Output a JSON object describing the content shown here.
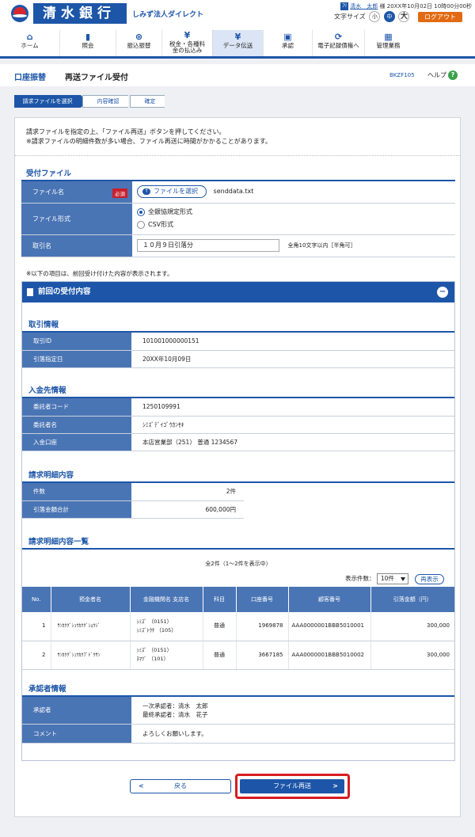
{
  "header": {
    "bank_name": "清水銀行",
    "service_name": "しみず法人ダイレクト",
    "user_icon_label": "ﾌﾘ",
    "user_name": "清水　太郎",
    "user_suffix": "様",
    "login_datetime": "20XX年10月02日 10時00分00秒",
    "font_size_label": "文字サイズ",
    "font_small": "小",
    "font_medium": "中",
    "font_large": "大",
    "logout": "ログアウト"
  },
  "nav": {
    "items": [
      {
        "label": "ホーム",
        "icon": "home-icon"
      },
      {
        "label": "照会",
        "icon": "document-icon"
      },
      {
        "label": "振込振替",
        "icon": "transfer-icon"
      },
      {
        "label": "税金・各種料金の払込み",
        "icon": "yen-icon"
      },
      {
        "label": "データ伝送",
        "icon": "data-transfer-icon"
      },
      {
        "label": "承認",
        "icon": "approval-icon"
      },
      {
        "label": "電子記録債権へ",
        "icon": "e-claim-icon"
      },
      {
        "label": "管理業務",
        "icon": "admin-icon"
      }
    ],
    "active_index": 4
  },
  "title": {
    "category": "口座振替",
    "main": "再送ファイル受付",
    "screen_id": "BKZF105",
    "help": "ヘルプ"
  },
  "steps": [
    "請求ファイルを選択",
    "内容確認",
    "確定"
  ],
  "intro": {
    "line1": "請求ファイルを指定の上、「ファイル再送」ボタンを押してください。",
    "line2": "※請求ファイルの明細件数が多い場合、ファイル再送に時間がかかることがあります。"
  },
  "upload": {
    "section_title": "受付ファイル",
    "file_label": "ファイル名",
    "required_badge": "必須",
    "select_button": "ファイルを選択",
    "file_name": "senddata.txt",
    "format_label": "ファイル形式",
    "format_option1": "全銀協規定形式",
    "format_option2": "CSV形式",
    "trade_name_label": "取引名",
    "trade_name_value": "１０月９日引落分",
    "trade_name_hint": "全角10文字以内［半角可］"
  },
  "previous_note": "※以下の項目は、前回受け付けた内容が表示されます。",
  "previous": {
    "panel_title": "前回の受付内容",
    "trade_section": "取引情報",
    "trade_id_label": "取引ID",
    "trade_id_value": "101001000000151",
    "debit_date_label": "引落指定日",
    "debit_date_value": "20XX年10月09日",
    "payee_section": "入金先情報",
    "consignor_code_label": "委託者コード",
    "consignor_code_value": "1250109991",
    "consignor_name_label": "委託者名",
    "consignor_name_value": "ｼﾐｽﾞﾃﾞｲｺﾞｳｶﾝｾｷ",
    "deposit_account_label": "入金口座",
    "deposit_account_value": "本店営業部（251） 普通 1234567",
    "detail_section": "請求明細内容",
    "count_label": "件数",
    "count_value": "2件",
    "total_label": "引落金額合計",
    "total_value": "600,000円",
    "list_section": "請求明細内容一覧",
    "list_count": "全2件（1～2件を表示中）",
    "per_page_label": "表示件数：",
    "per_page_value": "10件",
    "redisplay": "再表示",
    "columns": [
      "No.",
      "預金者名",
      "金融機関名 支店名",
      "科目",
      "口座番号",
      "顧客番号",
      "引落金額（円）"
    ],
    "rows": [
      {
        "no": "1",
        "depositor": "ｻﾝｶｸｸﾞｼｭｳｶｸｸﾞｼｮｳｼﾞ",
        "bank": "ｼﾐｽﾞ （0151）",
        "branch": "ｼﾐｽﾞﾄｳﾁ （105）",
        "type": "普通",
        "account": "1969878",
        "customer": "AAA0000001BBB5010001",
        "amount": "300,000"
      },
      {
        "no": "2",
        "depositor": "ｻﾝｶｸｸﾞｼｭｳｶｸﾌﾞﾄﾞｳｻﾝ",
        "bank": "ｼﾐｽﾞ （0151）",
        "branch": "ﾇﾏﾂﾞ （101）",
        "type": "普通",
        "account": "3667185",
        "customer": "AAA0000001BBB5010002",
        "amount": "300,000"
      }
    ],
    "approver_section": "承認者情報",
    "approver_label": "承認者",
    "approver_line1": "一次承認者：清水　太郎",
    "approver_line2": "最終承認者：清水　花子",
    "comment_label": "コメント",
    "comment_value": "よろしくお願いします。"
  },
  "buttons": {
    "back": "戻る",
    "resend": "ファイル再送"
  }
}
